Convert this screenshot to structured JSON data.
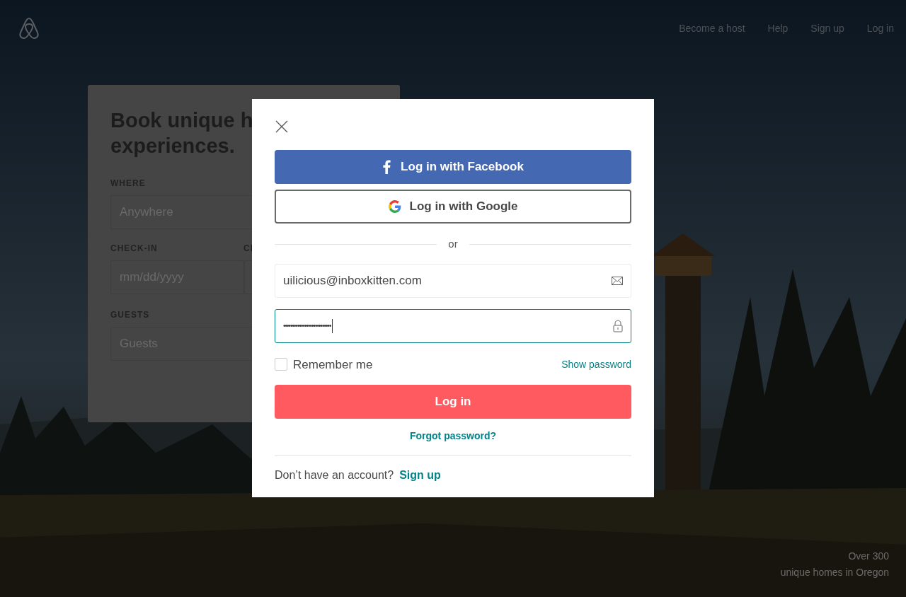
{
  "nav": [
    "Become a host",
    "Help",
    "Sign up",
    "Log in"
  ],
  "search_card": {
    "heading_lines": [
      "Book unique h",
      "experiences."
    ],
    "where": {
      "label": "WHERE",
      "placeholder": "Anywhere"
    },
    "dates": {
      "label": "CHECK-IN",
      "placeholder": "mm/dd/yyyy",
      "label_2": "CI"
    },
    "guests": {
      "label": "GUESTS",
      "placeholder": "Guests"
    }
  },
  "login_dialog": {
    "social_buttons": [
      {
        "kind": "facebook",
        "label": "Log in with Facebook"
      },
      {
        "kind": "google",
        "label": "Log in with Google"
      }
    ],
    "divider": "or",
    "email": {
      "value": "uilicious@inboxkitten.com",
      "focused": false
    },
    "password": {
      "value": "•••••••••••••••••••••••••••",
      "focused": true
    },
    "remember_me": {
      "label": "Remember me",
      "checked": false
    },
    "show_password": "Show password",
    "submit": "Log in",
    "forgot": "Forgot password?",
    "footer_text": "Don’t have an account?",
    "footer_link": "Sign up"
  },
  "caption": [
    "Over 300",
    "unique homes in Oregon"
  ]
}
